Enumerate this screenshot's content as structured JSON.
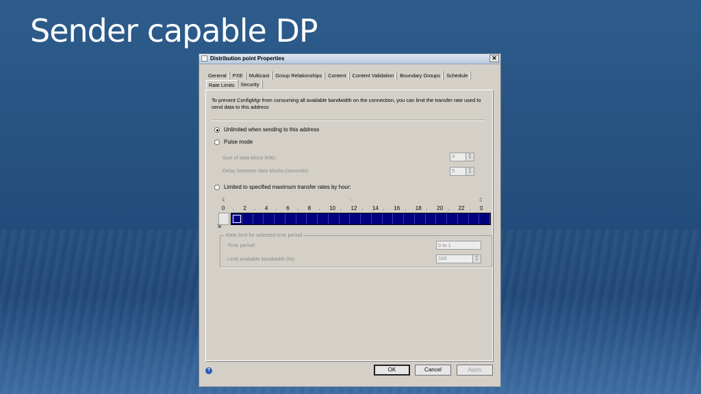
{
  "slide": {
    "title": "Sender capable DP"
  },
  "dialog": {
    "title": "Distribution point Properties",
    "close_glyph": "✕",
    "tabs_row1": [
      "General",
      "PXE",
      "Multicast",
      "Group Relationships",
      "Content",
      "Content Validation",
      "Boundary Groups",
      "Schedule"
    ],
    "tabs_row2": [
      "Rate Limits",
      "Security"
    ],
    "active_tab": "Rate Limits",
    "description": "To prevent ConfigMgr from consuming all available bandwidth on the connection, you can  limit the transfer rate used to send data to this address",
    "options": {
      "unlimited": "Unlimited when sending to this address",
      "pulse": "Pulse mode",
      "limited": "Limited to specified maximum transfer rates by hour:"
    },
    "selected_option": "unlimited",
    "pulse_fields": {
      "block_size_label": "Size of data block (KB):",
      "block_size_value": "3",
      "delay_label": "Delay between data blocks (seconds):",
      "delay_value": "5"
    },
    "hour_labels": [
      "0",
      ".",
      "2",
      ".",
      "4",
      ".",
      "6",
      ".",
      "8",
      ".",
      "10",
      ".",
      "12",
      ".",
      "14",
      ".",
      "16",
      ".",
      "18",
      ".",
      "20",
      ".",
      "22",
      ".",
      "0"
    ],
    "hour_cells": 24,
    "rate_group": {
      "legend": "Rate limit for selected time period",
      "time_period_label": "Time period:",
      "time_period_value": "0 to 1",
      "bandwidth_label": "Limit available bandwidth (%):",
      "bandwidth_value": "100"
    },
    "buttons": {
      "ok": "OK",
      "cancel": "Cancel",
      "apply": "Apply"
    },
    "icons": {
      "help": "help-icon",
      "moon": "moon-icon",
      "sun": "sun-icon"
    },
    "colors": {
      "hour_cell": "#000080",
      "dialog_bg": "#d4d0c8"
    }
  }
}
